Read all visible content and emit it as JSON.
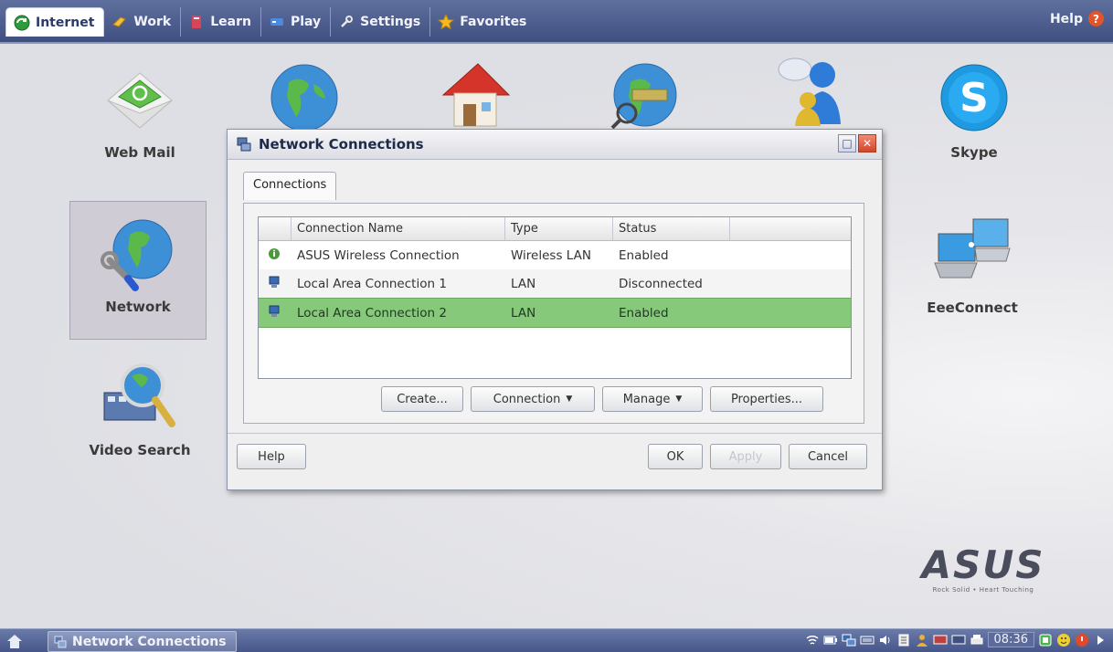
{
  "topbar": {
    "tabs": [
      {
        "label": "Internet",
        "icon": "internet-icon",
        "active": true
      },
      {
        "label": "Work",
        "icon": "work-icon",
        "active": false
      },
      {
        "label": "Learn",
        "icon": "learn-icon",
        "active": false
      },
      {
        "label": "Play",
        "icon": "play-icon",
        "active": false
      },
      {
        "label": "Settings",
        "icon": "settings-icon",
        "active": false
      },
      {
        "label": "Favorites",
        "icon": "star-icon",
        "active": false
      }
    ],
    "help_label": "Help"
  },
  "desktop": {
    "apps": [
      {
        "label": "Web Mail",
        "icon": "webmail-icon"
      },
      {
        "label": "",
        "icon": "globe-icon"
      },
      {
        "label": "",
        "icon": "home-icon"
      },
      {
        "label": "",
        "icon": "globe-search-icon"
      },
      {
        "label": "",
        "icon": "messenger-icon"
      },
      {
        "label": "Skype",
        "icon": "skype-icon"
      },
      {
        "label": "Network",
        "icon": "network-icon",
        "selected": true
      },
      {
        "label": "EeeConnect",
        "icon": "eeeconnect-icon"
      },
      {
        "label": "Video Search",
        "icon": "video-search-icon"
      }
    ],
    "logo_text": "ASUS",
    "logo_tagline": "Rock Solid • Heart Touching"
  },
  "dialog": {
    "title": "Network Connections",
    "tab_label": "Connections",
    "columns": [
      "",
      "Connection Name",
      "Type",
      "Status",
      ""
    ],
    "rows": [
      {
        "icon": "wireless-icon",
        "name": "ASUS Wireless Connection",
        "type": "Wireless LAN",
        "status": "Enabled",
        "selected": false
      },
      {
        "icon": "lan-icon",
        "name": "Local Area Connection 1",
        "type": "LAN",
        "status": "Disconnected",
        "selected": false
      },
      {
        "icon": "lan-icon",
        "name": "Local Area Connection 2",
        "type": "LAN",
        "status": "Enabled",
        "selected": true
      }
    ],
    "buttons": {
      "create": "Create...",
      "connection": "Connection",
      "manage": "Manage",
      "properties": "Properties...",
      "help": "Help",
      "ok": "OK",
      "apply": "Apply",
      "cancel": "Cancel"
    }
  },
  "taskbar": {
    "task_label": "Network Connections",
    "clock": "08:36"
  },
  "colors": {
    "accent": "#4f5f90",
    "selected_row": "#86c97a",
    "close_button": "#d2452a"
  }
}
